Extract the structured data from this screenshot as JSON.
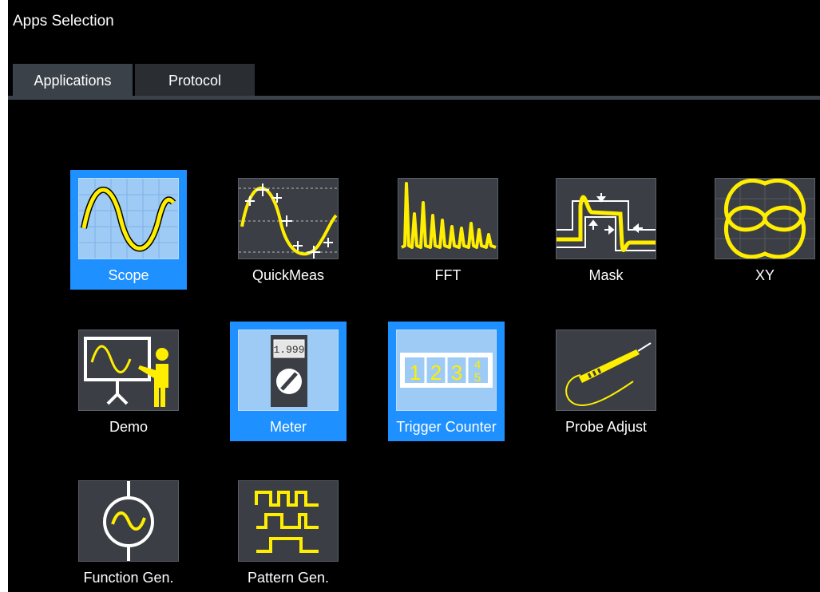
{
  "window": {
    "title": "Apps Selection"
  },
  "tabs": [
    {
      "label": "Applications",
      "active": true
    },
    {
      "label": "Protocol",
      "active": false
    }
  ],
  "apps": [
    {
      "label": "Scope",
      "icon": "scope-icon",
      "selected": true
    },
    {
      "label": "QuickMeas",
      "icon": "quickmeas-icon",
      "selected": false
    },
    {
      "label": "FFT",
      "icon": "fft-icon",
      "selected": false
    },
    {
      "label": "Mask",
      "icon": "mask-icon",
      "selected": false
    },
    {
      "label": "XY",
      "icon": "xy-icon",
      "selected": false
    },
    {
      "label": "Demo",
      "icon": "demo-icon",
      "selected": false
    },
    {
      "label": "Meter",
      "icon": "meter-icon",
      "selected": true,
      "display": "1.999"
    },
    {
      "label": "Trigger Counter",
      "icon": "trigger-counter-icon",
      "selected": true,
      "digits": [
        "1",
        "2",
        "3",
        "4",
        "5"
      ]
    },
    {
      "label": "Probe Adjust",
      "icon": "probe-adjust-icon",
      "selected": false
    },
    {
      "label": "Function Gen.",
      "icon": "function-gen-icon",
      "selected": false
    },
    {
      "label": "Pattern Gen.",
      "icon": "pattern-gen-icon",
      "selected": false
    }
  ],
  "colors": {
    "background": "#000000",
    "selection": "#1e90ff",
    "signal": "#ffee00",
    "tab_active": "#3b4148"
  }
}
